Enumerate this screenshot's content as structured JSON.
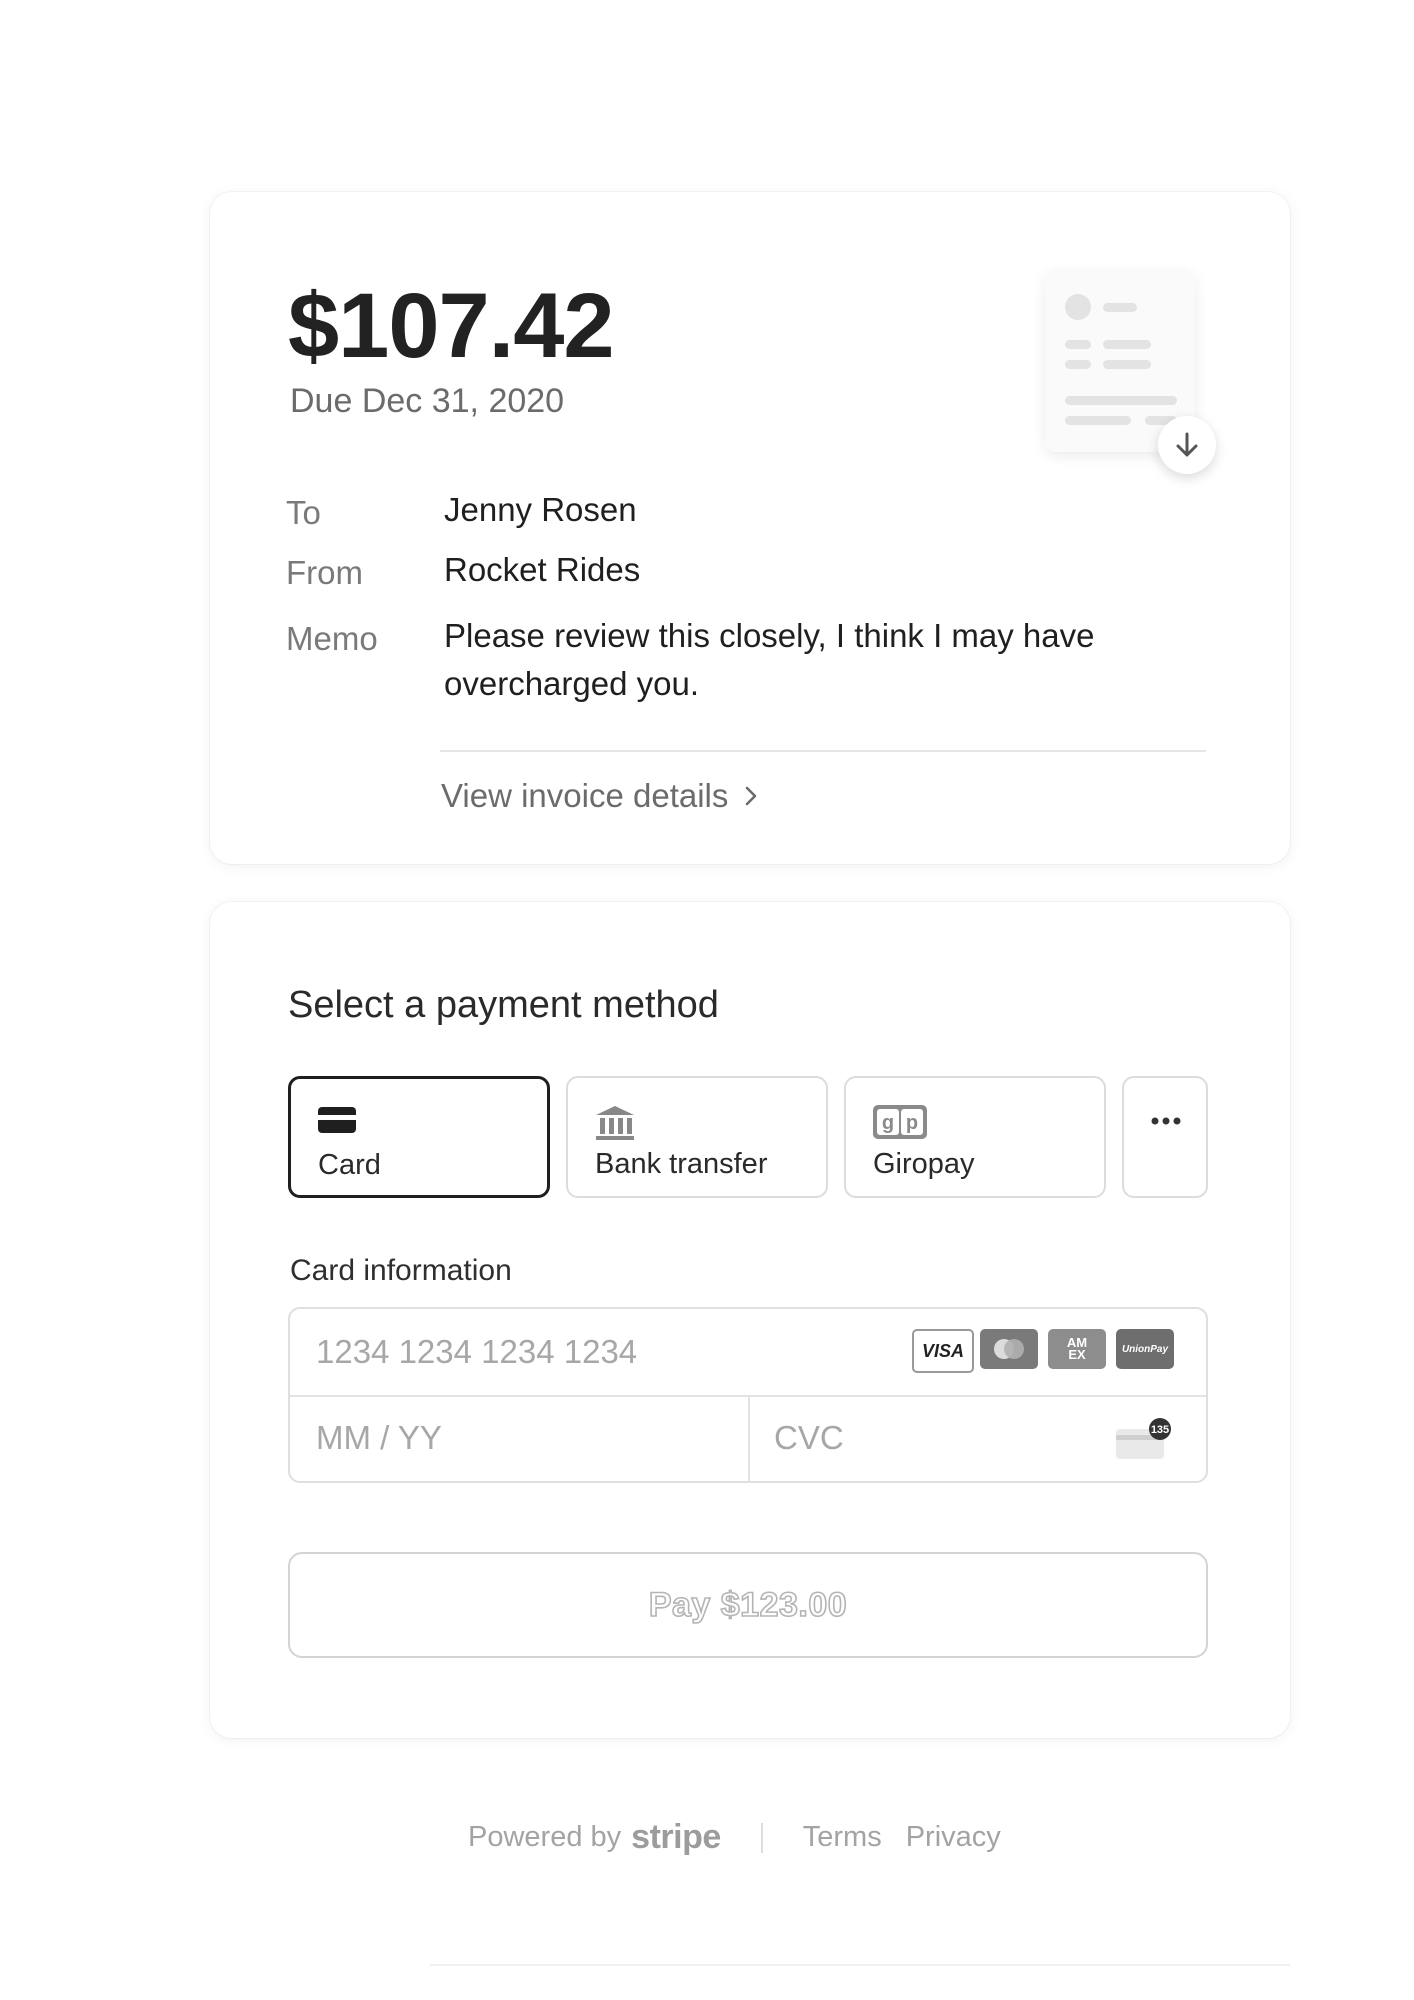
{
  "invoice": {
    "amount": "$107.42",
    "due": "Due Dec 31, 2020",
    "rows": [
      {
        "label": "To",
        "value": "Jenny Rosen"
      },
      {
        "label": "From",
        "value": "Rocket Rides"
      },
      {
        "label": "Memo",
        "value": "Please review this closely, I think I may have overcharged you."
      }
    ],
    "view_details": "View invoice details"
  },
  "payment": {
    "title": "Select a payment method",
    "methods": [
      {
        "label": "Card",
        "icon": "card-icon",
        "selected": true
      },
      {
        "label": "Bank transfer",
        "icon": "bank-icon",
        "selected": false
      },
      {
        "label": "Giropay",
        "icon": "giropay-icon",
        "selected": false
      },
      {
        "label": "",
        "icon": "more-icon",
        "selected": false
      }
    ],
    "card_info_label": "Card information",
    "card_number_placeholder": "1234 1234 1234 1234",
    "expiry_placeholder": "MM / YY",
    "cvc_placeholder": "CVC",
    "card_brands": [
      "VISA",
      "Mastercard",
      "AMEX",
      "UnionPay"
    ],
    "pay_button": "Pay $123.00"
  },
  "footer": {
    "powered_by": "Powered by",
    "brand": "stripe",
    "terms": "Terms",
    "privacy": "Privacy"
  },
  "colors": {
    "text": "#1f1f1f",
    "muted": "#6b6b6b",
    "border": "#dcdcdc",
    "selected_border": "#1f1f1f"
  }
}
